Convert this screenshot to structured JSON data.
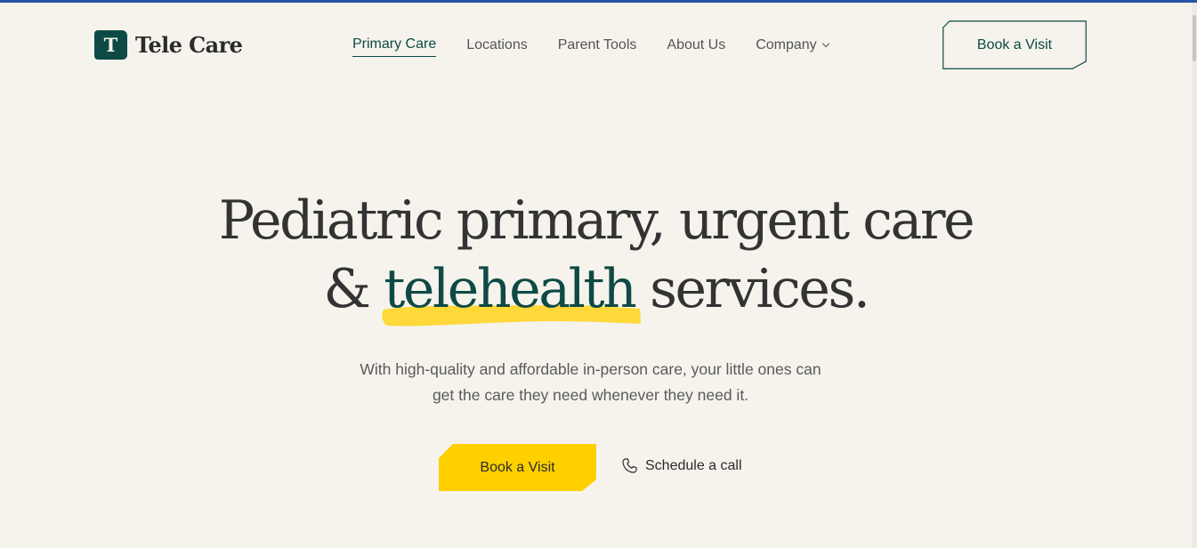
{
  "brand": {
    "logo_letter": "T",
    "name": "Tele Care"
  },
  "nav": {
    "items": [
      {
        "label": "Primary Care",
        "active": true
      },
      {
        "label": "Locations"
      },
      {
        "label": "Parent Tools"
      },
      {
        "label": "About Us"
      },
      {
        "label": "Company",
        "has_dropdown": true
      }
    ]
  },
  "header": {
    "book_label": "Book a Visit"
  },
  "hero": {
    "title_line1": "Pediatric primary, urgent care",
    "title_amp": "&",
    "title_highlight": "telehealth",
    "title_end": "services.",
    "subtitle_line1": "With high-quality and affordable in-person care, your little ones can",
    "subtitle_line2": "get the care they need whenever they need it.",
    "primary_cta": "Book a Visit",
    "secondary_cta": "Schedule a call"
  },
  "colors": {
    "accent": "#0e4a45",
    "highlight": "#ffd000",
    "background": "#f5f3ec",
    "top_bar": "#2754a8"
  },
  "icons": {
    "phone": "phone-icon",
    "dropdown": "chevron-down-icon"
  }
}
